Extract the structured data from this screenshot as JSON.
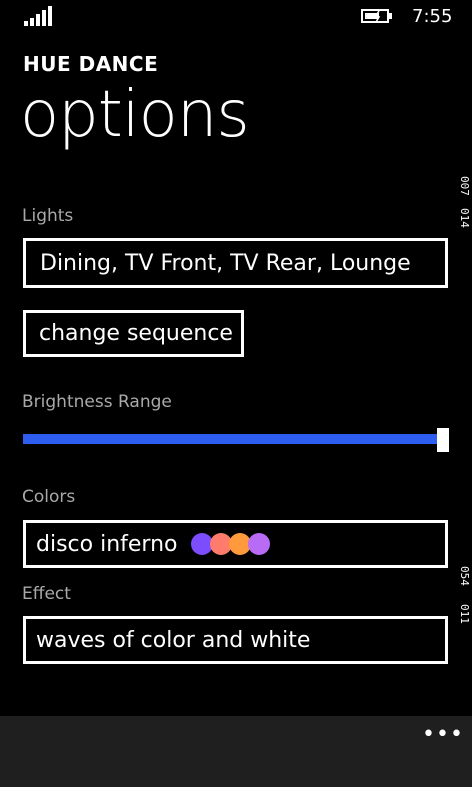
{
  "status": {
    "time": "7:55",
    "signal_icon": "signal-strength-icon",
    "battery_icon": "battery-charging-icon"
  },
  "app": {
    "name": "HUE DANCE",
    "page_title": "options"
  },
  "side_labels": {
    "top_left": "007",
    "top_right": "014",
    "bottom_left": "054",
    "bottom_right": "011"
  },
  "lights": {
    "label": "Lights",
    "value": "Dining, TV Front, TV Rear, Lounge",
    "change_sequence_label": "change sequence"
  },
  "brightness": {
    "label": "Brightness Range",
    "fill_fraction": 1.0,
    "accent": "#2e5ef0"
  },
  "colors": {
    "label": "Colors",
    "value": "disco inferno",
    "swatches": [
      "#7c4dff",
      "#ff7b6b",
      "#ff9a3c",
      "#b86cf5"
    ]
  },
  "effect": {
    "label": "Effect",
    "value": "waves of color and white"
  },
  "appbar": {
    "more": "•••"
  }
}
